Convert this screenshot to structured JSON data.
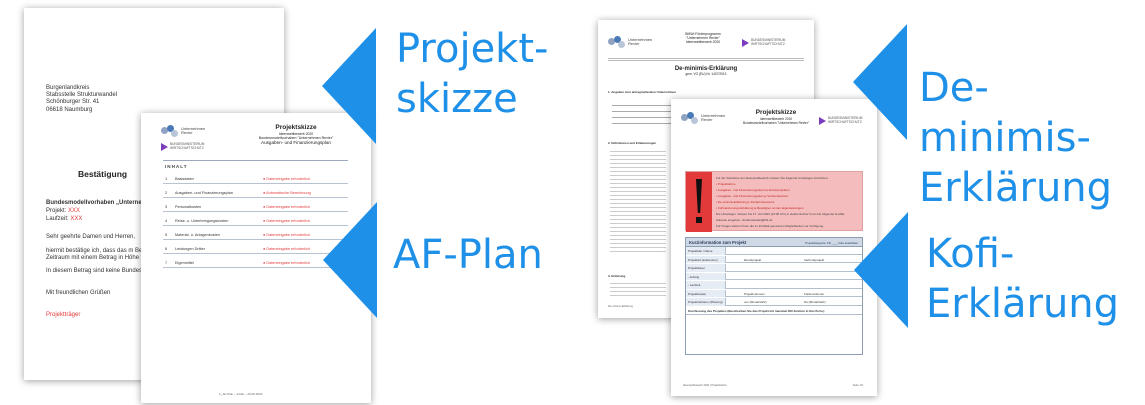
{
  "colors": {
    "accent": "#1e90e8",
    "warning": "#e23a3a",
    "table_head": "#cfd9e6"
  },
  "callouts": [
    {
      "id": "projektskizze",
      "label": "Projekt-\nskizze"
    },
    {
      "id": "af_plan",
      "label": "AF-Plan"
    },
    {
      "id": "de_minimis",
      "label": "De-minimis-\nErklärung"
    },
    {
      "id": "kofi",
      "label": "Kofi-\nErklärung"
    }
  ],
  "letter": {
    "address": [
      "Burgenlandkreis",
      "Stabsstelle Strukturwandel",
      "Schönburger Str. 41",
      "06618 Naumburg"
    ],
    "title": "Bestätigung",
    "project_line": "Bundesmodellvorhaben „Unterneh",
    "projekt_label": "Projekt:",
    "projekt_value": "XXX",
    "laufzeit_label": "Laufzeit:",
    "laufzeit_value": "XXX",
    "greeting": "Sehr geehrte Damen und Herren,",
    "body1": "hiermit bestätige ich, dass das m Betr",
    "body2": "Zeitraum mit einem Betrag in Höhe vo",
    "body3": "In diesem Betrag sind keine Bundesm",
    "closing": "Mit freundlichen Grüßen",
    "signature": "Projektträger"
  },
  "logos": {
    "unternehmen_revier": "Unternehmen\nRevier",
    "bmwi": "BUNDESMINISTERIUM\nWIRTSCHAFTSCHUTZ"
  },
  "af_plan": {
    "title": "Projektskizze",
    "sub1": "Ideenwettbewerb 2020",
    "sub2": "Bundesmodellvorhaben \"Unternehmen Revier\"",
    "sub3": "Ausgaben- und Finanzierungsplan",
    "inhalt": "INHALT",
    "rows": [
      {
        "n": "1",
        "label": "Basisdaten",
        "status": "Dateneingabe erforderlich"
      },
      {
        "n": "2",
        "label": "Ausgaben- und Finanzierungsplan",
        "status": "Automatische Berechnung"
      },
      {
        "n": "3",
        "label": "Personalkosten",
        "status": "Dateneingabe erforderlich"
      },
      {
        "n": "4",
        "label": "Reise- u. Unterbringungskosten",
        "status": "Dateneingabe erforderlich"
      },
      {
        "n": "5",
        "label": "Material- u. Anlagenkosten",
        "status": "Dateneingabe erforderlich"
      },
      {
        "n": "6",
        "label": "Leistungen Dritter",
        "status": "Dateneingabe erforderlich"
      },
      {
        "n": "7",
        "label": "Eigenmittel",
        "status": "Dateneingabe erforderlich"
      }
    ],
    "footer": "1_AF-Plan ~ Inhalt ~ 20.05.2020"
  },
  "deminimis": {
    "header1": "BMWi Förderprogramm",
    "header2": "\"Unternehmen Revier\"",
    "header3": "Ideenwettbewerb 2020",
    "title": "De-minimis-Erklärung",
    "subtitle": "gem. VO (EU) Nr. 1407/2013",
    "section1": "1. Angaben zum antragstellenden Unternehmen",
    "section2": "2. Definitionen und Erläuterungen",
    "section3": "3. Erklärung",
    "footer": "De-minimis-Erklärung"
  },
  "kofi": {
    "title": "Projektskizze",
    "sub1": "Ideenwettbewerb 2020",
    "sub2": "Bundesmodellvorhaben \"Unternehmen Revier\"",
    "notice": [
      "Für die Teilnahme am Ideenwettbewerb müssen Sie folgende Unterlagen einreichen:",
      "• Projektskizze",
      "• Ausgaben- und Finanzierungsplan bei Einzelprojekten",
      "• Ausgaben- und Finanzierungsplan je Verbundpartner",
      "• De-minimis-Erklärung je Förderinteressent",
      "• Kofinanzierungs-Erklärung je Beteiligten an den Eigenleistungen",
      "Die Unterlagen müssen bis 17. Juli 2020 (24:00 Uhr) in elektronischer Form bei folgender E-Mail-",
      "Adresse eingehen: strukturwandel@blk.de",
      "Für Fragen stehen Ihnen die im Infoblatt genannten Möglichkeiten zur Verfügung."
    ],
    "form_title": "Kurzinformation zum Projekt",
    "form_right": "Projektkategorie: FR ____ bitte auswählen",
    "form_rows": [
      [
        "Projekttitel / Name",
        "",
        ""
      ],
      [
        "Projektart (ankreuzen)",
        "Einzelprojekt",
        "Verbundprojekt"
      ],
      [
        "Projektdauer",
        "",
        ""
      ],
      [
        "- Anfang",
        "",
        ""
      ],
      [
        "- Laufzeit",
        "",
        ""
      ],
      [
        "Projektkosten",
        "Projektvolumen",
        "Fördervolumen"
      ],
      [
        "Projektzeitraum (Planung)",
        "von (Monat/Jahr)",
        "bis (Monat/Jahr)"
      ],
      [
        "Kurzfassung des Projektes (Beschreiben Sie das Projekt mit maximal 300 Zeichen in Kurzform.)",
        "",
        ""
      ]
    ],
    "footer_left": "Ideenwettbewerb 2020 | Projektskizze",
    "footer_right": "Seite 1/3"
  }
}
